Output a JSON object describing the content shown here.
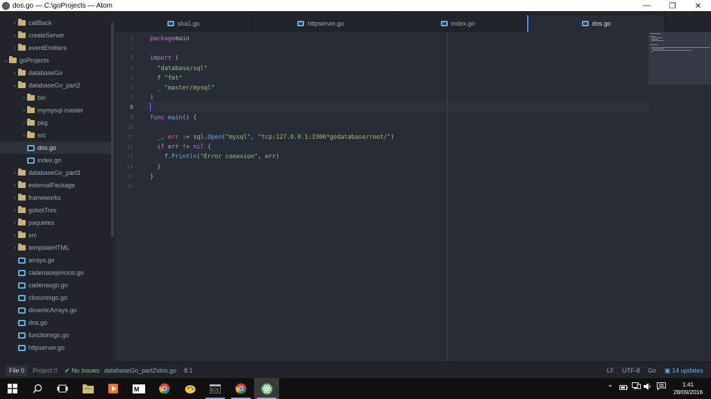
{
  "window": {
    "title": "dos.go — C:\\goProjects — Atom"
  },
  "tree": [
    {
      "label": "callBack",
      "kind": "folder",
      "chev": "›",
      "indent": 1,
      "selected": false
    },
    {
      "label": "createServer",
      "kind": "folder",
      "chev": "›",
      "indent": 1,
      "selected": false
    },
    {
      "label": "eventEmitters",
      "kind": "folder",
      "chev": "›",
      "indent": 1,
      "selected": false
    },
    {
      "label": "goProjects",
      "kind": "folder",
      "chev": "⌄",
      "indent": 0,
      "selected": false
    },
    {
      "label": "databaseGo",
      "kind": "folder",
      "chev": "›",
      "indent": 1,
      "selected": false
    },
    {
      "label": "databaseGo_part2",
      "kind": "folder",
      "chev": "⌄",
      "indent": 1,
      "selected": false
    },
    {
      "label": "bin",
      "kind": "folder",
      "chev": "›",
      "indent": 2,
      "selected": false
    },
    {
      "label": "mymysql-master",
      "kind": "folder",
      "chev": "›",
      "indent": 2,
      "selected": false
    },
    {
      "label": "pkg",
      "kind": "folder",
      "chev": "›",
      "indent": 2,
      "selected": false
    },
    {
      "label": "src",
      "kind": "folder",
      "chev": "›",
      "indent": 2,
      "selected": false
    },
    {
      "label": "dos.go",
      "kind": "file",
      "chev": "",
      "indent": 2,
      "selected": true
    },
    {
      "label": "index.go",
      "kind": "file",
      "chev": "",
      "indent": 2,
      "selected": false
    },
    {
      "label": "databaseGo_part3",
      "kind": "folder",
      "chev": "›",
      "indent": 1,
      "selected": false
    },
    {
      "label": "externalPackage",
      "kind": "folder",
      "chev": "›",
      "indent": 1,
      "selected": false
    },
    {
      "label": "frameworks",
      "kind": "folder",
      "chev": "›",
      "indent": 1,
      "selected": false
    },
    {
      "label": "gobotTres",
      "kind": "folder",
      "chev": "›",
      "indent": 1,
      "selected": false
    },
    {
      "label": "paquetes",
      "kind": "folder",
      "chev": "›",
      "indent": 1,
      "selected": false
    },
    {
      "label": "src",
      "kind": "folder",
      "chev": "›",
      "indent": 1,
      "selected": false
    },
    {
      "label": "templateHTML",
      "kind": "folder",
      "chev": "›",
      "indent": 1,
      "selected": false
    },
    {
      "label": "arrays.go",
      "kind": "file",
      "chev": "",
      "indent": 1,
      "selected": false
    },
    {
      "label": "cadenasejericios.go",
      "kind": "file",
      "chev": "",
      "indent": 1,
      "selected": false
    },
    {
      "label": "cadenasgo.go",
      "kind": "file",
      "chev": "",
      "indent": 1,
      "selected": false
    },
    {
      "label": "closuresgo.go",
      "kind": "file",
      "chev": "",
      "indent": 1,
      "selected": false
    },
    {
      "label": "dinamicArrays.go",
      "kind": "file",
      "chev": "",
      "indent": 1,
      "selected": false
    },
    {
      "label": "dos.go",
      "kind": "file",
      "chev": "",
      "indent": 1,
      "selected": false
    },
    {
      "label": "functionsgo.go",
      "kind": "file",
      "chev": "",
      "indent": 1,
      "selected": false
    },
    {
      "label": "httpserver.go",
      "kind": "file",
      "chev": "",
      "indent": 1,
      "selected": false
    }
  ],
  "tabs": [
    {
      "label": "sha1.go",
      "active": false
    },
    {
      "label": "httpserver.go",
      "active": false
    },
    {
      "label": "index.go",
      "active": false
    },
    {
      "label": "dos.go",
      "active": true
    }
  ],
  "editor": {
    "current_line": 8,
    "lines": [
      [
        [
          "kw",
          "package"
        ],
        [
          "",
          "main"
        ]
      ],
      [],
      [
        [
          "kw",
          "import"
        ],
        [
          "",
          " ("
        ]
      ],
      [
        [
          "",
          "  "
        ],
        [
          "str",
          "\"database/sql\""
        ]
      ],
      [
        [
          "",
          "  f "
        ],
        [
          "str",
          "\"fmt\""
        ]
      ],
      [
        [
          "",
          "  _ "
        ],
        [
          "str",
          "\"master/mysql\""
        ]
      ],
      [
        [
          "",
          ")"
        ]
      ],
      [],
      [
        [
          "kw",
          "func"
        ],
        [
          "",
          " "
        ],
        [
          "fn",
          "main"
        ],
        [
          "",
          "() {"
        ]
      ],
      [],
      [
        [
          "",
          "  _, "
        ],
        [
          "var",
          "err"
        ],
        [
          "",
          " := sql."
        ],
        [
          "fn",
          "Open"
        ],
        [
          "",
          "("
        ],
        [
          "str",
          "\"mysql\""
        ],
        [
          "",
          ", "
        ],
        [
          "str",
          "\"tcp:127.0.0.1:3306*godatabase/root/\""
        ],
        [
          "",
          ")"
        ]
      ],
      [
        [
          "",
          "  "
        ],
        [
          "kw",
          "if"
        ],
        [
          "",
          " err != "
        ],
        [
          "kw",
          "nil"
        ],
        [
          "",
          " {"
        ]
      ],
      [
        [
          "",
          "    f."
        ],
        [
          "fn",
          "Println"
        ],
        [
          "",
          "("
        ],
        [
          "str",
          "\"Error conexion\""
        ],
        [
          "",
          ", err)"
        ]
      ],
      [
        [
          "",
          "  }"
        ]
      ],
      [
        [
          "",
          "}"
        ]
      ],
      []
    ]
  },
  "status": {
    "file_count": "File 0",
    "project_count": "Project 0",
    "issues": "No Issues",
    "path": "databaseGo_part2\\dos.go",
    "cursor": "8:1",
    "line_ending": "LF",
    "encoding": "UTF-8",
    "grammar": "Go",
    "updates": "14 updates"
  },
  "clock": {
    "time": "1:41",
    "date": "28/09/2016"
  }
}
